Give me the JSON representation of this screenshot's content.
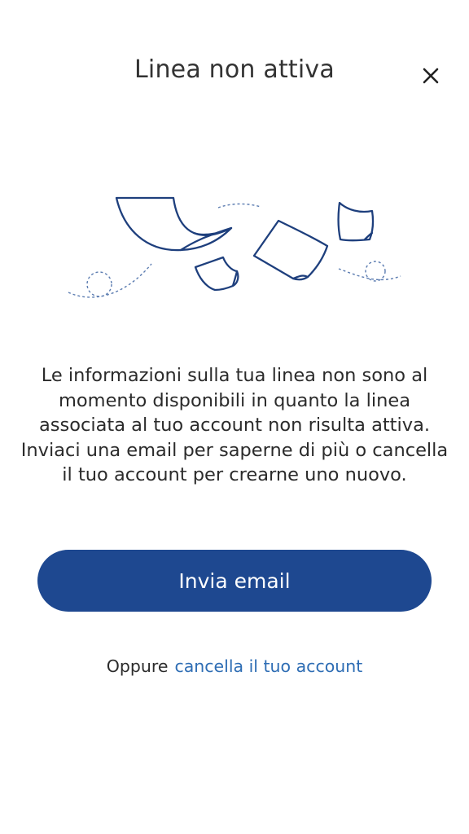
{
  "header": {
    "title": "Linea non attiva",
    "close_icon": "close-icon"
  },
  "illustration": {
    "icon": "flying-papers-illustration",
    "stroke_color": "#1e3f7d",
    "dash_color": "#5a7bb0"
  },
  "message": {
    "text": "Le informazioni sulla tua linea non sono al momento disponibili in quanto la linea associata al tuo account non risulta attiva. Inviaci una email per saperne di più o cancella il tuo account per crearne uno nuovo."
  },
  "actions": {
    "primary_label": "Invia email",
    "alt_prefix": "Oppure",
    "alt_link": "cancella il tuo account"
  },
  "colors": {
    "primary": "#1e4890",
    "link": "#2e6db4",
    "text": "#2b2b2b"
  }
}
